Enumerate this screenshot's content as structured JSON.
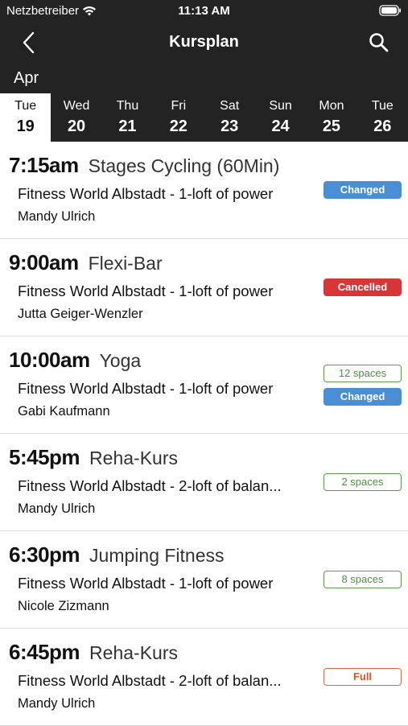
{
  "status_bar": {
    "carrier": "Netzbetreiber",
    "time": "11:13 AM"
  },
  "nav": {
    "title": "Kursplan"
  },
  "month": "Apr",
  "days": [
    {
      "name": "Tue",
      "num": "19",
      "selected": true
    },
    {
      "name": "Wed",
      "num": "20",
      "selected": false
    },
    {
      "name": "Thu",
      "num": "21",
      "selected": false
    },
    {
      "name": "Fri",
      "num": "22",
      "selected": false
    },
    {
      "name": "Sat",
      "num": "23",
      "selected": false
    },
    {
      "name": "Sun",
      "num": "24",
      "selected": false
    },
    {
      "name": "Mon",
      "num": "25",
      "selected": false
    },
    {
      "name": "Tue",
      "num": "26",
      "selected": false
    }
  ],
  "classes": [
    {
      "time": "7:15am",
      "course": "Stages Cycling (60Min)",
      "location": "Fitness World Albstadt - 1-loft of power",
      "trainer": "Mandy Ulrich",
      "badges": [
        {
          "type": "changed",
          "label": "Changed"
        }
      ]
    },
    {
      "time": "9:00am",
      "course": "Flexi-Bar",
      "location": "Fitness World Albstadt - 1-loft of power",
      "trainer": "Jutta Geiger-Wenzler",
      "badges": [
        {
          "type": "cancelled",
          "label": "Cancelled"
        }
      ]
    },
    {
      "time": "10:00am",
      "course": "Yoga",
      "location": "Fitness World Albstadt - 1-loft of power",
      "trainer": "Gabi Kaufmann",
      "badges": [
        {
          "type": "spaces",
          "label": "12 spaces"
        },
        {
          "type": "changed",
          "label": "Changed"
        }
      ]
    },
    {
      "time": "5:45pm",
      "course": "Reha-Kurs",
      "location": "Fitness World Albstadt - 2-loft of balan...",
      "trainer": "Mandy Ulrich",
      "badges": [
        {
          "type": "spaces",
          "label": "2 spaces"
        }
      ]
    },
    {
      "time": "6:30pm",
      "course": "Jumping Fitness",
      "location": "Fitness World Albstadt - 1-loft of power",
      "trainer": "Nicole Zizmann",
      "badges": [
        {
          "type": "spaces",
          "label": "8 spaces"
        }
      ]
    },
    {
      "time": "6:45pm",
      "course": "Reha-Kurs",
      "location": "Fitness World Albstadt - 2-loft of balan...",
      "trainer": "Mandy Ulrich",
      "badges": [
        {
          "type": "full",
          "label": "Full"
        }
      ]
    }
  ],
  "colors": {
    "header_bg": "#232323",
    "changed": "#4a8fd6",
    "cancelled": "#d83636",
    "spaces": "#5a9e4a",
    "full": "#e06a3c"
  }
}
